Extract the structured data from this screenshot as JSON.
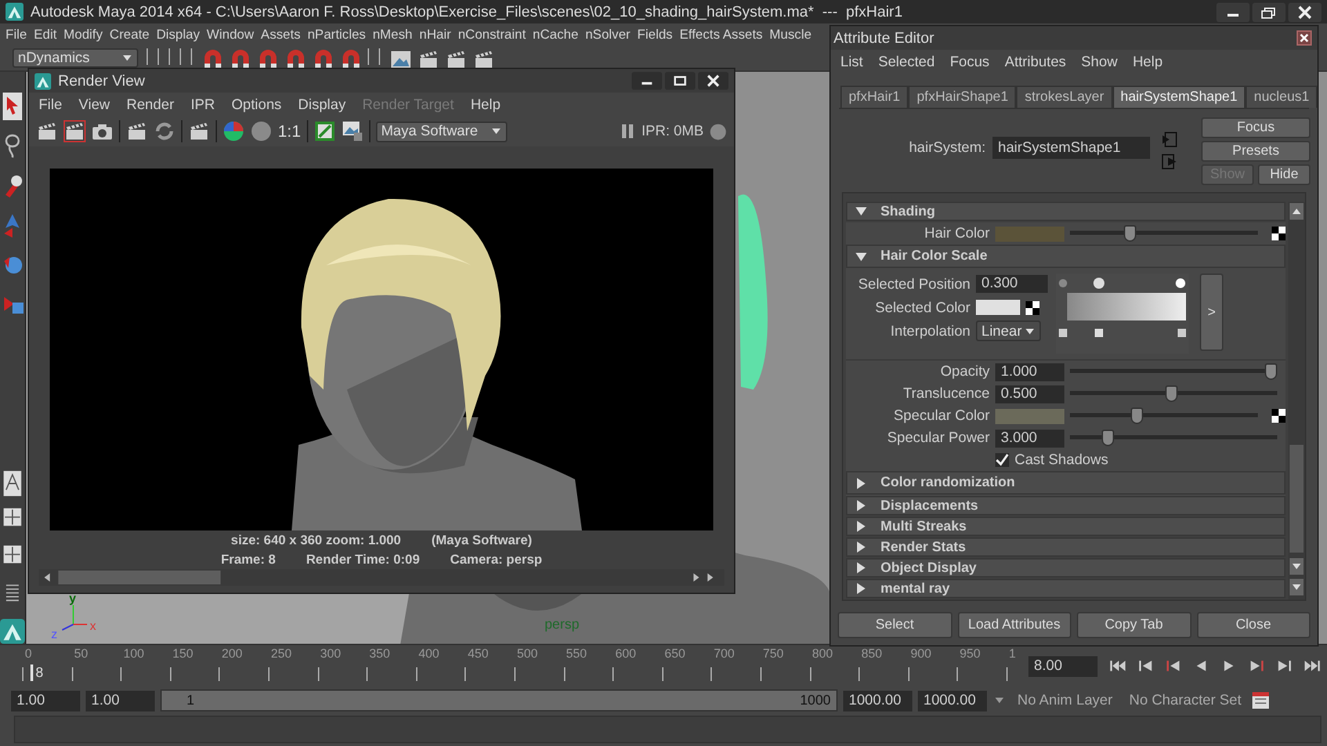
{
  "app_window": {
    "title": "Autodesk Maya 2014 x64 - C:\\Users\\Aaron F. Ross\\Desktop\\Exercise_Files\\scenes\\02_10_shading_hairSystem.ma*  ---  pfxHair1"
  },
  "menu_bar": [
    "File",
    "Edit",
    "Modify",
    "Create",
    "Display",
    "Window",
    "Assets",
    "nParticles",
    "nMesh",
    "nHair",
    "nConstraint",
    "nCache",
    "nSolver",
    "Fields",
    "Effects Assets",
    "Muscle"
  ],
  "shelf": {
    "menu_set": "nDynamics"
  },
  "viewport": {
    "camera_label": "persp",
    "axis_labels": [
      "y",
      "z",
      "x"
    ]
  },
  "render_view": {
    "title": "Render View",
    "menu": [
      {
        "label": "File",
        "disabled": false
      },
      {
        "label": "View",
        "disabled": false
      },
      {
        "label": "Render",
        "disabled": false
      },
      {
        "label": "IPR",
        "disabled": false
      },
      {
        "label": "Options",
        "disabled": false
      },
      {
        "label": "Display",
        "disabled": false
      },
      {
        "label": "Render Target",
        "disabled": true
      },
      {
        "label": "Help",
        "disabled": false
      }
    ],
    "ratio_label": "1:1",
    "renderer": "Maya Software",
    "ipr_status": "IPR: 0MB",
    "info": {
      "size": "size: 640 x 360 zoom: 1.000",
      "renderer": "(Maya Software)",
      "frame": "Frame: 8",
      "render_time": "Render Time: 0:09",
      "camera": "Camera: persp"
    }
  },
  "attribute_editor": {
    "title": "Attribute Editor",
    "menu": [
      "List",
      "Selected",
      "Focus",
      "Attributes",
      "Show",
      "Help"
    ],
    "tabs": [
      {
        "label": "pfxHair1",
        "selected": false
      },
      {
        "label": "pfxHairShape1",
        "selected": false
      },
      {
        "label": "strokesLayer",
        "selected": false
      },
      {
        "label": "hairSystemShape1",
        "selected": true
      },
      {
        "label": "nucleus1",
        "selected": false
      }
    ],
    "node": {
      "label": "hairSystem:",
      "value": "hairSystemShape1"
    },
    "side_buttons": [
      {
        "label": "Focus",
        "disabled": false
      },
      {
        "label": "Presets",
        "disabled": false
      },
      {
        "label": "Show",
        "disabled": true
      },
      {
        "label": "Hide",
        "disabled": false
      }
    ],
    "shading": {
      "title": "Shading",
      "expanded": true,
      "hair_color": {
        "label": "Hair Color",
        "color": "#5b5339",
        "level": 0.31
      },
      "color_scale": {
        "title": "Hair Color Scale",
        "expanded": true,
        "ramp_button": ">",
        "selected_position": {
          "label": "Selected Position",
          "value": "0.300"
        },
        "selected_color": {
          "label": "Selected Color",
          "color": "#e0e0e0"
        },
        "interpolation": {
          "label": "Interpolation",
          "value": "Linear"
        }
      },
      "rows": [
        {
          "kind": "number",
          "label": "Opacity",
          "value": "1.000",
          "level": 1.0
        },
        {
          "kind": "number",
          "label": "Translucence",
          "value": "0.500",
          "level": 0.49
        },
        {
          "kind": "color",
          "label": "Specular Color",
          "color": "#6b6a5a",
          "level": 0.35
        },
        {
          "kind": "number",
          "label": "Specular Power",
          "value": "3.000",
          "level": 0.16
        },
        {
          "kind": "checkbox",
          "label": "Cast Shadows",
          "checked": true
        }
      ],
      "subsections": [
        {
          "title": "Color randomization",
          "expanded": false
        }
      ]
    },
    "sections": [
      {
        "title": "Displacements",
        "expanded": false
      },
      {
        "title": "Multi Streaks",
        "expanded": false
      },
      {
        "title": "Render Stats",
        "expanded": false
      },
      {
        "title": "Object Display",
        "expanded": false
      },
      {
        "title": "mental ray",
        "expanded": false
      }
    ],
    "footer_buttons": [
      "Select",
      "Load Attributes",
      "Copy Tab",
      "Close"
    ]
  },
  "time_slider": {
    "ticks": [
      "0",
      "50",
      "100",
      "150",
      "200",
      "250",
      "300",
      "350",
      "400",
      "450",
      "500",
      "550",
      "600",
      "650",
      "700",
      "750",
      "800",
      "850",
      "900",
      "950",
      "1"
    ],
    "current_frame": "8",
    "level": 0.008,
    "current_time": "8.00"
  },
  "range_slider": {
    "start_time": "1.00",
    "playback_start": "1.00",
    "range_start": "1",
    "range_end": "1000",
    "level": 1.0,
    "playback_end": "1000.00",
    "end_time": "1000.00",
    "anim_layer": "No Anim Layer",
    "character_set": "No Character Set"
  }
}
